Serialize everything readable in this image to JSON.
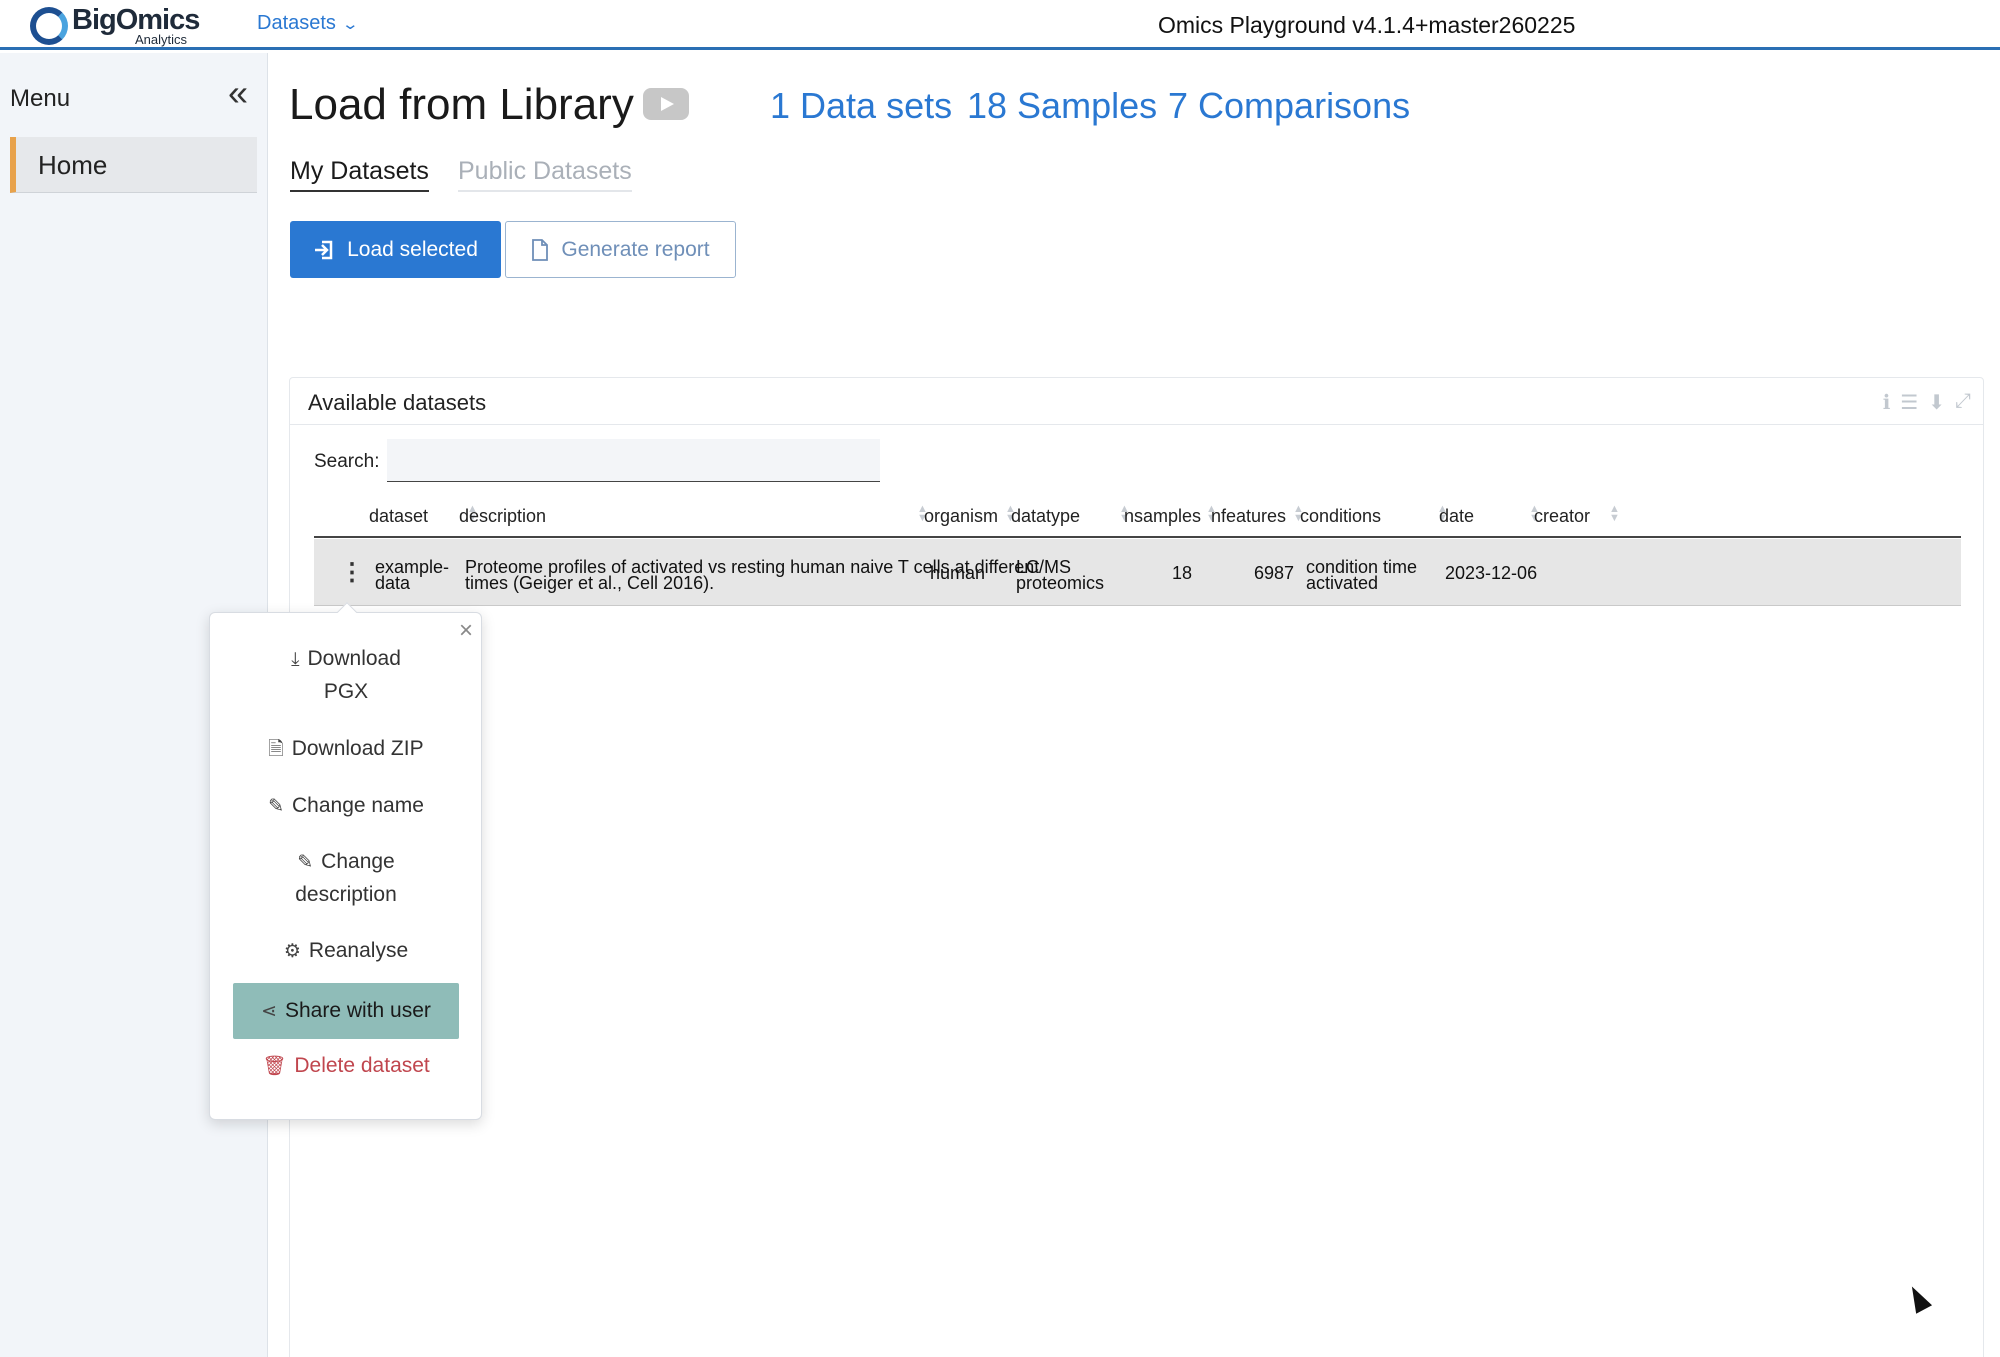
{
  "brand": {
    "title": "BigOmics",
    "subtitle": "Analytics"
  },
  "topbar": {
    "nav_label": "Datasets",
    "app_version": "Omics Playground v4.1.4+master260225"
  },
  "sidebar": {
    "menu_title": "Menu",
    "items": [
      {
        "label": "Home"
      }
    ]
  },
  "header": {
    "title": "Load from Library",
    "stats": {
      "datasets": "1 Data sets",
      "samples": "18 Samples",
      "comparisons": "7 Comparisons"
    }
  },
  "tabs": [
    {
      "label": "My Datasets",
      "active": true
    },
    {
      "label": "Public Datasets",
      "active": false
    }
  ],
  "buttons": {
    "load": "Load selected",
    "report": "Generate report"
  },
  "card": {
    "title": "Available datasets",
    "search_label": "Search:",
    "search_value": "",
    "columns": [
      "dataset",
      "description",
      "organism",
      "datatype",
      "nsamples",
      "nfeatures",
      "conditions",
      "date",
      "creator"
    ],
    "rows": [
      {
        "dataset_l1": "example-",
        "dataset_l2": "data",
        "description_l1": "Proteome profiles of activated vs resting human naive T cells at different",
        "description_l2": "times (Geiger et al., Cell 2016).",
        "organism": "human",
        "datatype_l1": "LC/MS",
        "datatype_l2": "proteomics",
        "nsamples": "18",
        "nfeatures": "6987",
        "conditions_l1": "condition time",
        "conditions_l2": "activated",
        "date": "2023-12-06",
        "creator": ""
      }
    ]
  },
  "popover": {
    "close": "×",
    "items": {
      "download_pgx_l1": "Download",
      "download_pgx_l2": "PGX",
      "download_zip": "Download ZIP",
      "change_name": "Change name",
      "change_desc_l1": "Change",
      "change_desc_l2": "description",
      "reanalyse": "Reanalyse",
      "share": "Share with user",
      "delete": "Delete dataset"
    }
  },
  "colors": {
    "accent": "#2a78d2",
    "share_bg": "#8fbcb8",
    "delete": "#c0464e",
    "home_marker": "#e8a24b"
  }
}
